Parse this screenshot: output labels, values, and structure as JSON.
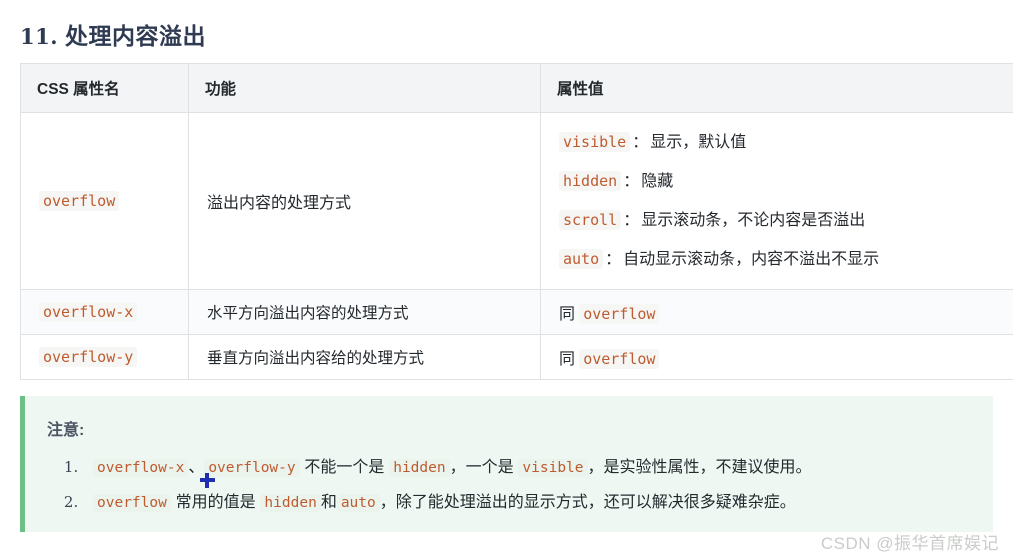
{
  "heading": {
    "number": "11.",
    "title": "处理内容溢出"
  },
  "table": {
    "columns": [
      "CSS 属性名",
      "功能",
      "属性值"
    ],
    "rows": [
      {
        "property": "overflow",
        "function": "溢出内容的处理方式",
        "values": [
          {
            "code": "visible",
            "sep": "：",
            "desc": "显示，默认值"
          },
          {
            "code": "hidden",
            "sep": "：",
            "desc": "隐藏"
          },
          {
            "code": "scroll",
            "sep": "：",
            "desc": "显示滚动条，不论内容是否溢出"
          },
          {
            "code": "auto",
            "sep": "：",
            "desc": "自动显示滚动条，内容不溢出不显示"
          }
        ]
      },
      {
        "property": "overflow-x",
        "function": "水平方向溢出内容的处理方式",
        "value_prefix": "同",
        "value_code": "overflow"
      },
      {
        "property": "overflow-y",
        "function": "垂直方向溢出内容给的处理方式",
        "value_prefix": "同",
        "value_code": "overflow"
      }
    ]
  },
  "note": {
    "title": "注意:",
    "items": [
      {
        "code1": "overflow-x",
        "mid1": "、",
        "code2": "overflow-y",
        "mid2": "不能一个是",
        "code3": "hidden",
        "mid3": "，一个是",
        "code4": "visible",
        "tail": "，是实验性属性，不建议使用。"
      },
      {
        "code1": "overflow",
        "mid1": "常用的值是",
        "code2": "hidden",
        "mid2": "和",
        "code3": "auto",
        "tail": "，除了能处理溢出的显示方式，还可以解决很多疑难杂症。"
      }
    ]
  },
  "watermark": "CSDN @振华首席娱记",
  "colors": {
    "heading": "#2f3b52",
    "code": "#bf5b30",
    "note_border": "#6dbf85",
    "note_bg": "#eef7f1",
    "table_header_bg": "#f3f4f6",
    "table_border": "#dfe2e5",
    "cursor": "#1f2fb0",
    "watermark": "#c9ccc9"
  }
}
